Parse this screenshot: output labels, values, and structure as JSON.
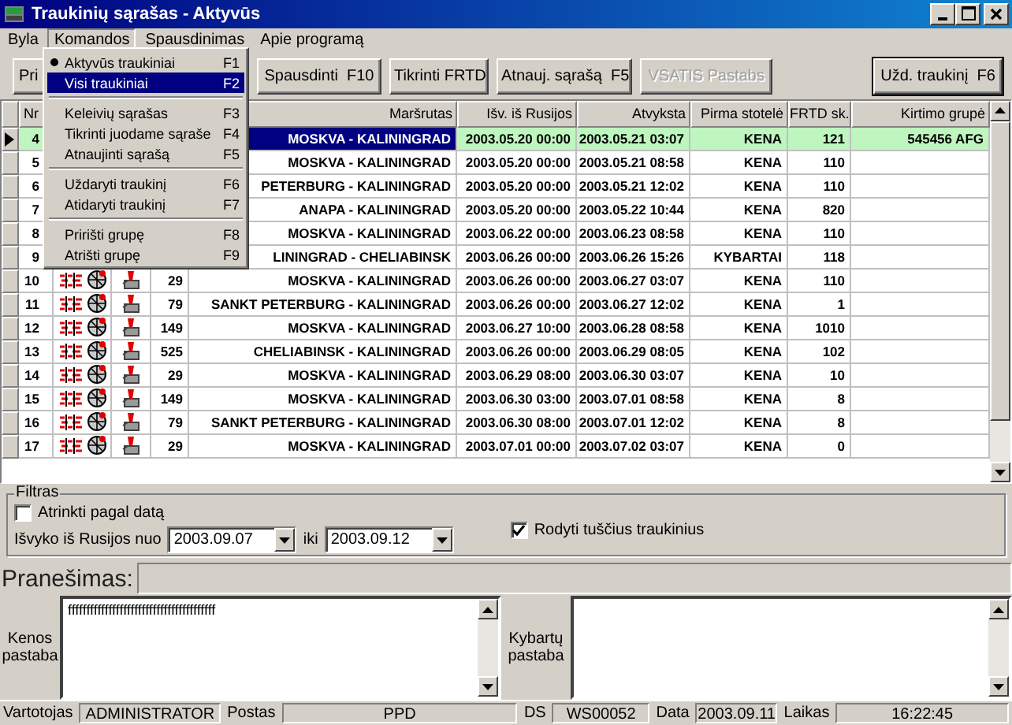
{
  "window": {
    "title": "Traukinių sąrašas - Aktyvūs"
  },
  "menu_bar": [
    {
      "label": "Byla",
      "selected": false
    },
    {
      "label": "Komandos",
      "selected": true
    },
    {
      "label": "Spausdinimas",
      "selected": false
    },
    {
      "label": "Apie programą",
      "selected": false
    }
  ],
  "toolbar": [
    {
      "label": "Pri",
      "disabled": false,
      "default": false
    },
    {
      "label": "Spausdinti  F10",
      "disabled": false,
      "default": false
    },
    {
      "label": "Tikrinti FRTD",
      "disabled": false,
      "default": false
    },
    {
      "label": "Atnauj. sąrašą  F5",
      "disabled": false,
      "default": false
    },
    {
      "label": "VSATIS Pastabs",
      "disabled": true,
      "default": false
    },
    {
      "label": "Užd. traukinį  F6",
      "disabled": false,
      "default": true
    }
  ],
  "open_menu": {
    "groups": [
      [
        {
          "label": "Aktyvūs traukiniai",
          "shortcut": "F1",
          "checked": true,
          "selected": false
        },
        {
          "label": "Visi traukiniai",
          "shortcut": "F2",
          "checked": false,
          "selected": true
        }
      ],
      [
        {
          "label": "Keleivių sąrašas",
          "shortcut": "F3",
          "checked": false,
          "selected": false
        },
        {
          "label": "Tikrinti juodame sąraše",
          "shortcut": "F4",
          "checked": false,
          "selected": false
        },
        {
          "label": "Atnaujinti sąrašą",
          "shortcut": "F5",
          "checked": false,
          "selected": false
        }
      ],
      [
        {
          "label": "Uždaryti traukinį",
          "shortcut": "F6",
          "checked": false,
          "selected": false
        },
        {
          "label": "Atidaryti traukinį",
          "shortcut": "F7",
          "checked": false,
          "selected": false
        }
      ],
      [
        {
          "label": "Pririšti grupę",
          "shortcut": "F8",
          "checked": false,
          "selected": false
        },
        {
          "label": "Atrišti grupę",
          "shortcut": "F9",
          "checked": false,
          "selected": false
        }
      ]
    ]
  },
  "table": {
    "columns": [
      "Nr",
      "Maršrutas",
      "Išv. iš Rusijos",
      "Atvyksta",
      "Pirma stotelė",
      "FRTD sk.",
      "Kirtimo grupė"
    ],
    "rows": [
      {
        "nr": "4",
        "route": "MOSKVA - KALININGRAD",
        "departure": "2003.05.20 00:00",
        "arrival": "2003.05.21 03:07",
        "first_stop": "KENA",
        "frtd": "121",
        "group": "545456 AFG",
        "selected": true
      },
      {
        "nr": "5",
        "route": "MOSKVA - KALININGRAD",
        "departure": "2003.05.20 00:00",
        "arrival": "2003.05.21 08:58",
        "first_stop": "KENA",
        "frtd": "110",
        "selected": false
      },
      {
        "nr": "6",
        "route": "PETERBURG - KALININGRAD",
        "departure": "2003.05.20 00:00",
        "arrival": "2003.05.21 12:02",
        "first_stop": "KENA",
        "frtd": "110",
        "selected": false
      },
      {
        "nr": "7",
        "route": "ANAPA - KALININGRAD",
        "departure": "2003.05.20 00:00",
        "arrival": "2003.05.22 10:44",
        "first_stop": "KENA",
        "frtd": "820",
        "selected": false
      },
      {
        "nr": "8",
        "route": "MOSKVA - KALININGRAD",
        "departure": "2003.06.22 00:00",
        "arrival": "2003.06.23 08:58",
        "first_stop": "KENA",
        "frtd": "110",
        "selected": false
      },
      {
        "nr": "9",
        "route": "LININGRAD - CHELIABINSK",
        "departure": "2003.06.26 00:00",
        "arrival": "2003.06.26 15:26",
        "first_stop": "KYBARTAI",
        "frtd": "118",
        "selected": false
      },
      {
        "nr": "10",
        "number": "29",
        "route": "MOSKVA - KALININGRAD",
        "departure": "2003.06.26 00:00",
        "arrival": "2003.06.27 03:07",
        "first_stop": "KENA",
        "frtd": "110",
        "selected": false
      },
      {
        "nr": "11",
        "number": "79",
        "route": "SANKT PETERBURG - KALININGRAD",
        "departure": "2003.06.26 00:00",
        "arrival": "2003.06.27 12:02",
        "first_stop": "KENA",
        "frtd": "1",
        "selected": false
      },
      {
        "nr": "12",
        "number": "149",
        "route": "MOSKVA - KALININGRAD",
        "departure": "2003.06.27 10:00",
        "arrival": "2003.06.28 08:58",
        "first_stop": "KENA",
        "frtd": "1010",
        "selected": false
      },
      {
        "nr": "13",
        "number": "525",
        "route": "CHELIABINSK - KALININGRAD",
        "departure": "2003.06.26 00:00",
        "arrival": "2003.06.29 08:05",
        "first_stop": "KENA",
        "frtd": "102",
        "selected": false
      },
      {
        "nr": "14",
        "number": "29",
        "route": "MOSKVA - KALININGRAD",
        "departure": "2003.06.29 08:00",
        "arrival": "2003.06.30 03:07",
        "first_stop": "KENA",
        "frtd": "10",
        "selected": false
      },
      {
        "nr": "15",
        "number": "149",
        "route": "MOSKVA - KALININGRAD",
        "departure": "2003.06.30 03:00",
        "arrival": "2003.07.01 08:58",
        "first_stop": "KENA",
        "frtd": "8",
        "selected": false
      },
      {
        "nr": "16",
        "number": "79",
        "route": "SANKT PETERBURG - KALININGRAD",
        "departure": "2003.06.30 08:00",
        "arrival": "2003.07.01 12:02",
        "first_stop": "KENA",
        "frtd": "8",
        "selected": false
      },
      {
        "nr": "17",
        "number": "29",
        "route": "MOSKVA - KALININGRAD",
        "departure": "2003.07.01 00:00",
        "arrival": "2003.07.02 03:07",
        "first_stop": "KENA",
        "frtd": "0",
        "selected": false
      }
    ]
  },
  "filter": {
    "title": "Filtras",
    "by_date": {
      "label": "Atrinkti pagal datą",
      "checked": false
    },
    "from_label": "Išvyko iš Rusijos nuo",
    "from": "2003.09.07",
    "to_label": "iki",
    "to": "2003.09.12",
    "show_empty": {
      "label": "Rodyti tuščius traukinius",
      "checked": true
    }
  },
  "message": {
    "label": "Pranešimas:"
  },
  "notes": [
    {
      "label": "Kenos pastaba",
      "value": "ffffffffffffffffffffffffffffffffffffffff"
    },
    {
      "label": "Kybartų pastaba"
    }
  ],
  "status_bar": [
    {
      "label": "Vartotojas",
      "value": "ADMINISTRATOR"
    },
    {
      "label": "Postas",
      "value": "PPD"
    },
    {
      "label": "DS",
      "value": "WS00052"
    },
    {
      "label": "Data",
      "value": "2003.09.11"
    },
    {
      "label": "Laikas",
      "value": "16:22:45"
    }
  ]
}
